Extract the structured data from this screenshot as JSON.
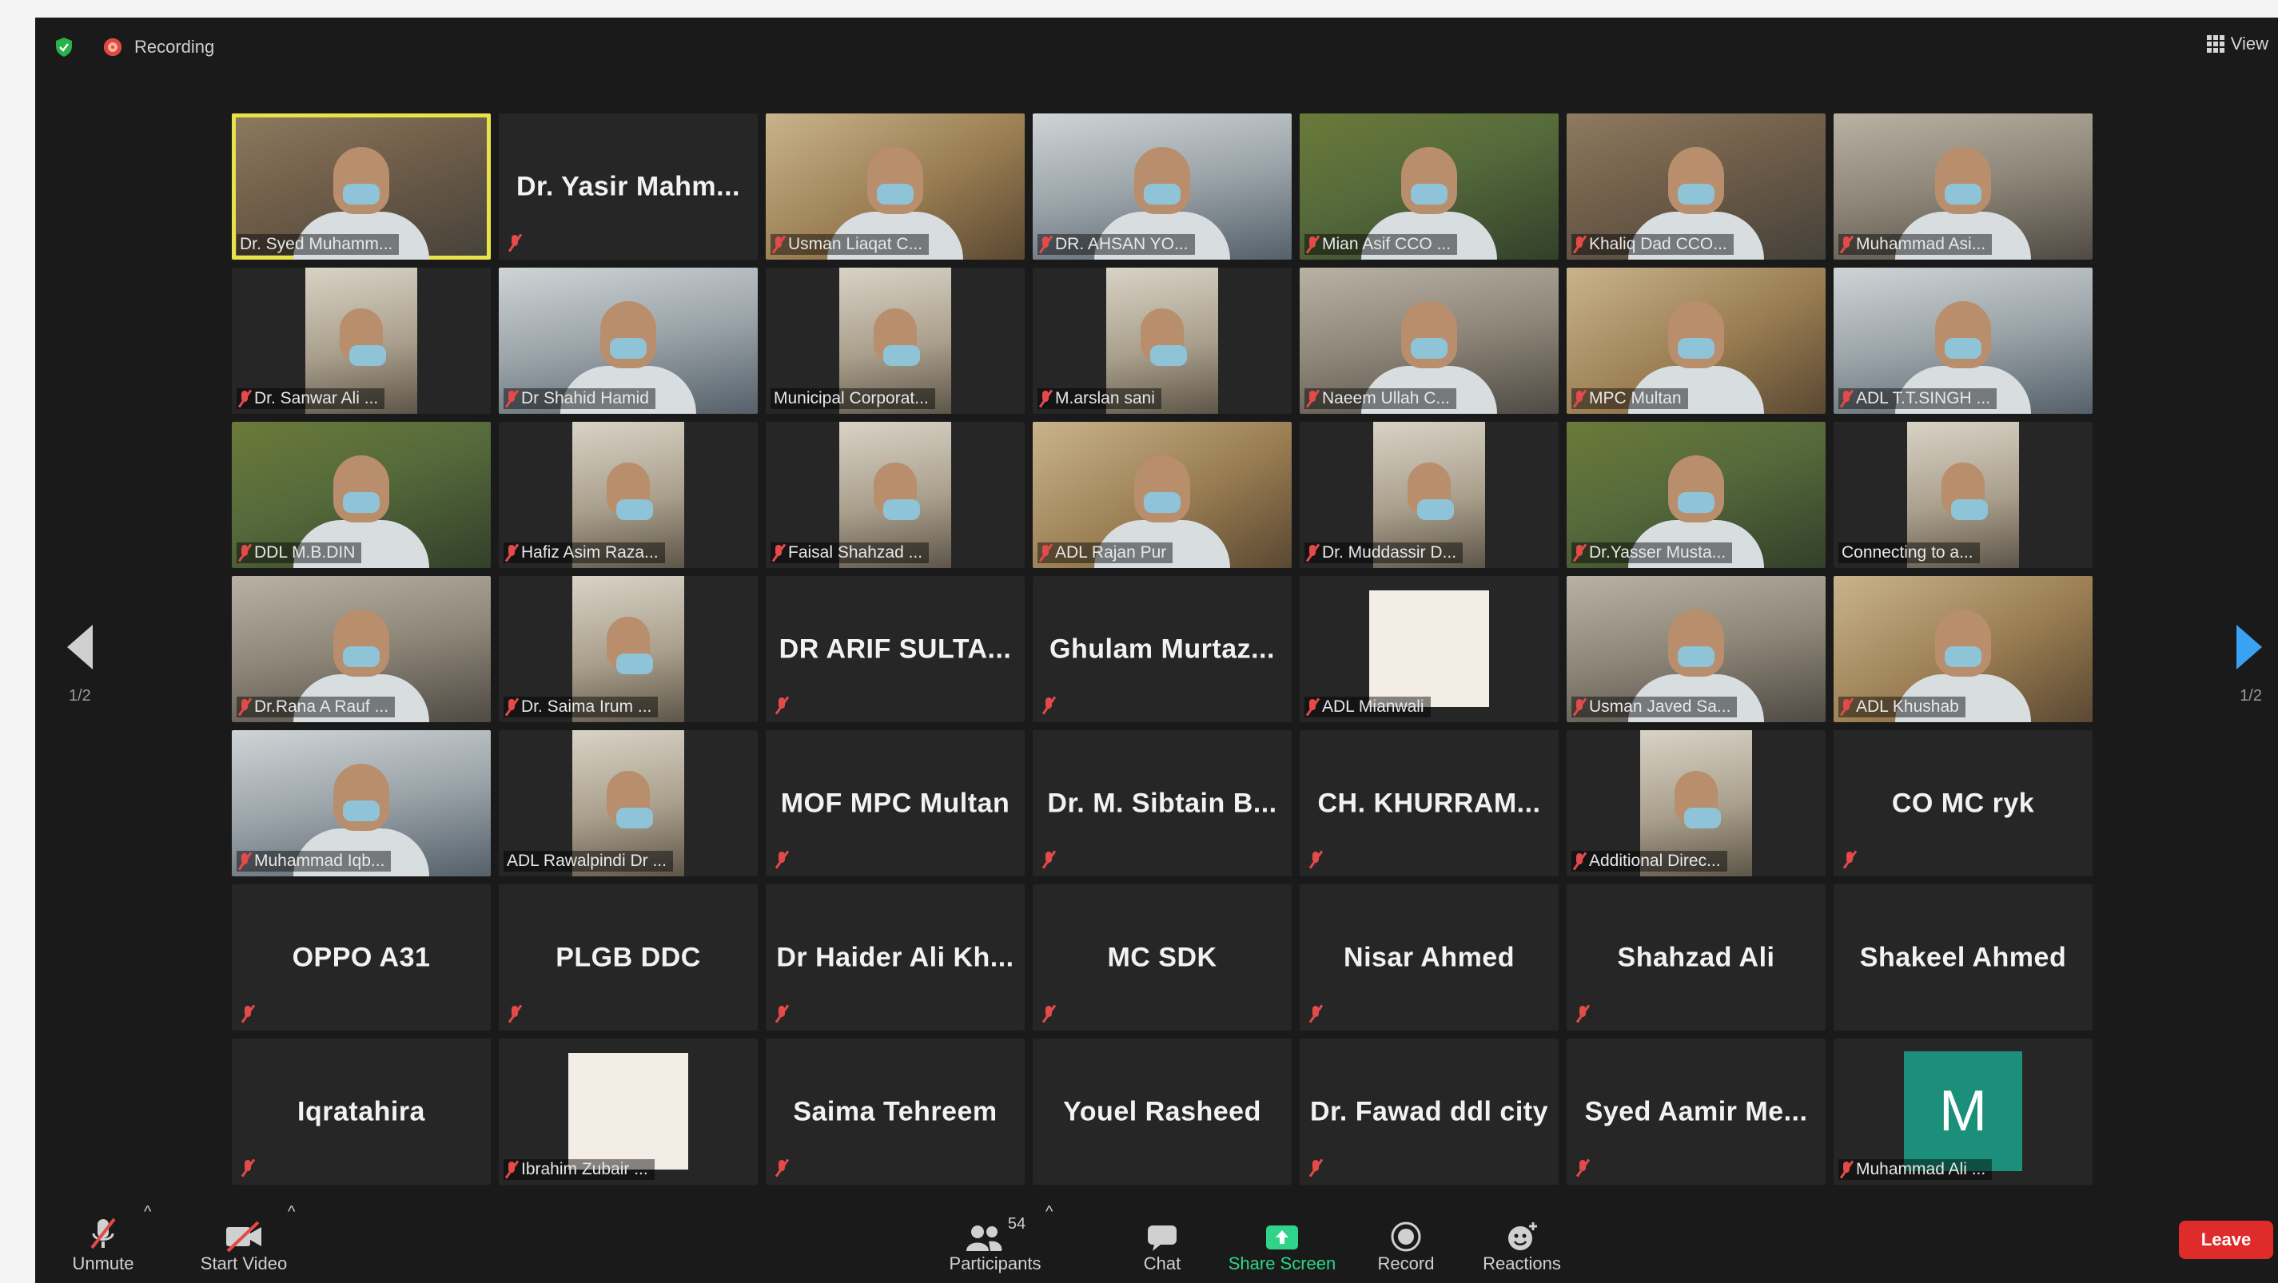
{
  "topbar": {
    "recording_label": "Recording",
    "view_label": "View"
  },
  "pagination": {
    "left": "1/2",
    "right": "1/2"
  },
  "tiles": [
    {
      "name": "Dr. Syed Muhamm...",
      "type": "photo",
      "active": true,
      "muted": false
    },
    {
      "name": "Dr. Yasir Mahm...",
      "type": "name",
      "muted": true
    },
    {
      "name": "Usman Liaqat C...",
      "type": "photo",
      "muted": true
    },
    {
      "name": "DR. AHSAN YO...",
      "type": "photo",
      "muted": true
    },
    {
      "name": "Mian Asif CCO ...",
      "type": "photo",
      "muted": true
    },
    {
      "name": "Khaliq Dad CCO...",
      "type": "photo",
      "muted": true
    },
    {
      "name": "Muhammad Asi...",
      "type": "photo",
      "muted": true
    },
    {
      "name": "Dr. Sanwar Ali ...",
      "type": "narrow",
      "muted": true
    },
    {
      "name": "Dr Shahid Hamid",
      "type": "photo",
      "muted": true
    },
    {
      "name": "Municipal Corporat...",
      "type": "narrow",
      "muted": false
    },
    {
      "name": "M.arslan sani",
      "type": "narrow",
      "muted": true
    },
    {
      "name": "Naeem Ullah C...",
      "type": "photo",
      "muted": true
    },
    {
      "name": "MPC Multan",
      "type": "photo",
      "muted": true
    },
    {
      "name": "ADL T.T.SINGH ...",
      "type": "photo",
      "muted": true
    },
    {
      "name": "DDL M.B.DIN",
      "type": "photo",
      "muted": true
    },
    {
      "name": "Hafiz Asim Raza...",
      "type": "narrow",
      "muted": true
    },
    {
      "name": "Faisal Shahzad ...",
      "type": "narrow",
      "muted": true
    },
    {
      "name": "ADL Rajan Pur",
      "type": "photo",
      "muted": true
    },
    {
      "name": "Dr. Muddassir D...",
      "type": "narrow",
      "muted": true
    },
    {
      "name": "Dr.Yasser Musta...",
      "type": "photo",
      "muted": true
    },
    {
      "name": "Connecting to a...",
      "type": "narrow",
      "muted": false
    },
    {
      "name": "Dr.Rana A Rauf ...",
      "type": "photo",
      "muted": true
    },
    {
      "name": "Dr. Saima Irum ...",
      "type": "narrow",
      "muted": true
    },
    {
      "name": "DR ARIF SULTA...",
      "type": "name",
      "muted": true
    },
    {
      "name": "Ghulam Murtaz...",
      "type": "name",
      "muted": true
    },
    {
      "name": "ADL Mianwali",
      "type": "screen",
      "muted": true
    },
    {
      "name": "Usman Javed Sa...",
      "type": "photo",
      "muted": true
    },
    {
      "name": "ADL Khushab",
      "type": "photo",
      "muted": true
    },
    {
      "name": "Muhammad Iqb...",
      "type": "photo",
      "muted": true
    },
    {
      "name": "ADL Rawalpindi Dr ...",
      "type": "narrow",
      "muted": false
    },
    {
      "name": "MOF MPC Multan",
      "type": "name",
      "muted": true
    },
    {
      "name": "Dr. M. Sibtain B...",
      "type": "name",
      "muted": true
    },
    {
      "name": "CH. KHURRAM...",
      "type": "name",
      "muted": true
    },
    {
      "name": "Additional Direc...",
      "type": "narrow",
      "muted": true
    },
    {
      "name": "CO MC ryk",
      "type": "name",
      "muted": true
    },
    {
      "name": "OPPO A31",
      "type": "name",
      "muted": true
    },
    {
      "name": "PLGB DDC",
      "type": "name",
      "muted": true
    },
    {
      "name": "Dr Haider Ali Kh...",
      "type": "name",
      "muted": true
    },
    {
      "name": "MC SDK",
      "type": "name",
      "muted": true
    },
    {
      "name": "Nisar Ahmed",
      "type": "name",
      "muted": true
    },
    {
      "name": "Shahzad Ali",
      "type": "name",
      "muted": true
    },
    {
      "name": "Shakeel Ahmed",
      "type": "name",
      "muted": false
    },
    {
      "name": "Iqratahira",
      "type": "name",
      "muted": true
    },
    {
      "name": "Ibrahim Zubair ...",
      "type": "screen",
      "muted": true
    },
    {
      "name": "Saima Tehreem",
      "type": "name",
      "muted": true
    },
    {
      "name": "Youel Rasheed",
      "type": "name",
      "muted": false
    },
    {
      "name": "Dr. Fawad ddl city",
      "type": "name",
      "muted": true
    },
    {
      "name": "Syed Aamir Me...",
      "type": "name",
      "muted": true
    },
    {
      "name": "Muhammad Ali ...",
      "type": "avatar",
      "avatar_letter": "M",
      "muted": true
    }
  ],
  "toolbar": {
    "unmute": "Unmute",
    "start_video": "Start Video",
    "participants": "Participants",
    "participants_count": "54",
    "chat": "Chat",
    "share_screen": "Share Screen",
    "record": "Record",
    "reactions": "Reactions",
    "leave": "Leave"
  },
  "colors": {
    "accent_active": "#e9e34a",
    "leave": "#e02b2b",
    "share": "#2fd48a",
    "avatar": "#1b8f7a"
  }
}
